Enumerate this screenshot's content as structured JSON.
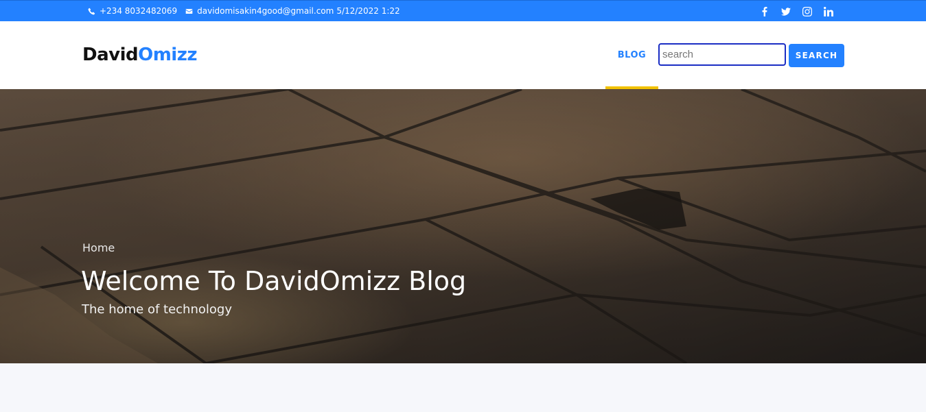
{
  "topbar": {
    "phone": "+234 8032482069",
    "email": "davidomisakin4good@gmail.com",
    "datetime": "5/12/2022 1:22",
    "social_icons": [
      "facebook-icon",
      "twitter-icon",
      "instagram-icon",
      "linkedin-icon"
    ]
  },
  "header": {
    "logo_first": "David",
    "logo_second": "Omizz",
    "nav": {
      "blog": "BLOG"
    },
    "search": {
      "placeholder": "search",
      "value": "",
      "button": "SEARCH"
    }
  },
  "hero": {
    "breadcrumb": "Home",
    "title": "Welcome To DavidOmizz Blog",
    "subtitle": "The home of technology"
  },
  "colors": {
    "primary": "#2381ff",
    "accent_underline": "#f2c200",
    "search_border": "#1a2dc4"
  }
}
